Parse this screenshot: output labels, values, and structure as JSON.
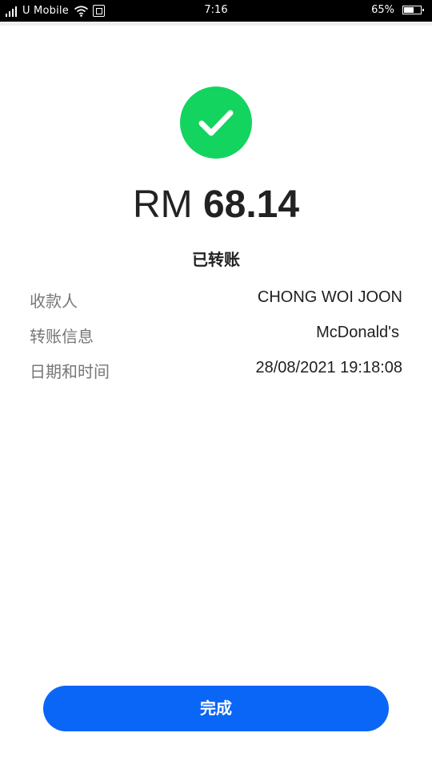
{
  "status_bar": {
    "carrier": "U Mobile",
    "time": "7:16",
    "battery": "65%",
    "battery_level": 0.65,
    "icons": [
      "signal-icon",
      "wifi-icon",
      "nfc-icon",
      "battery-icon"
    ]
  },
  "receipt": {
    "currency": "RM",
    "amount": "68.14",
    "status": "已转账",
    "status_color": "#12d45e"
  },
  "details": [
    {
      "label": "收款人",
      "value": "CHONG WOI JOON"
    },
    {
      "label": "转账信息",
      "value": "McDonald's"
    },
    {
      "label": "日期和时间",
      "value": "28/08/2021 19:18:08"
    }
  ],
  "actions": {
    "done_label": "完成",
    "button_color": "#0a66f7"
  }
}
